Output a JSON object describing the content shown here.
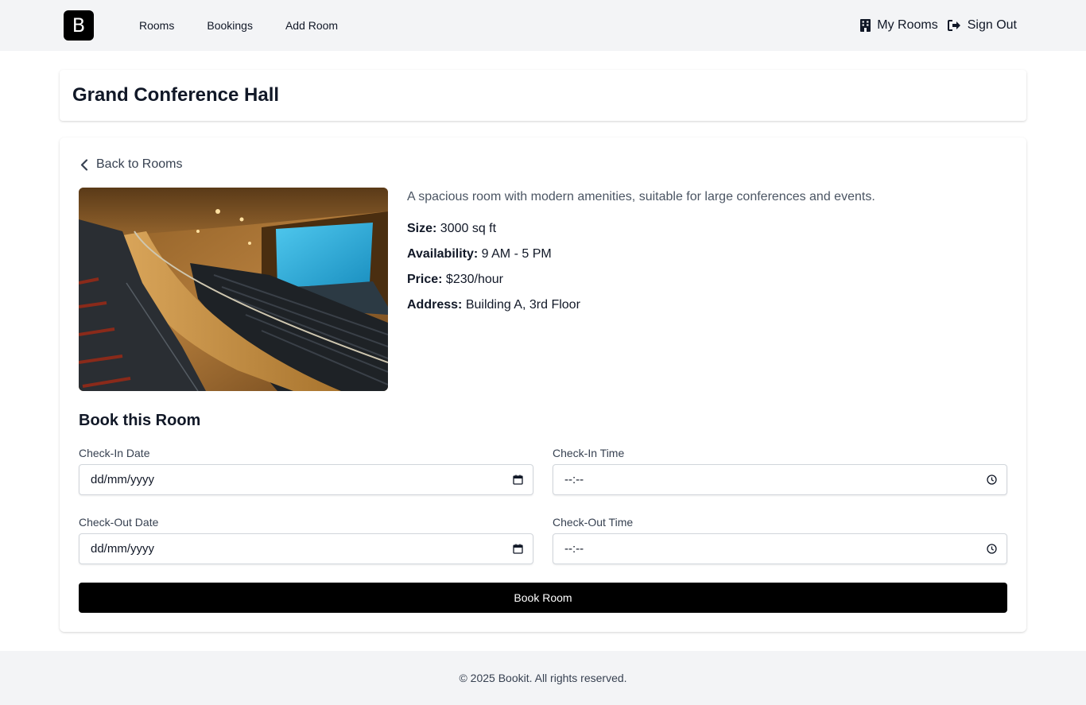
{
  "nav": {
    "logo": "B",
    "links": [
      "Rooms",
      "Bookings",
      "Add Room"
    ],
    "my_rooms": "My Rooms",
    "sign_out": "Sign Out"
  },
  "room": {
    "title": "Grand Conference Hall",
    "back_label": "Back to Rooms",
    "description": "A spacious room with modern amenities, suitable for large conferences and events.",
    "details": [
      {
        "label": "Size:",
        "value": "3000 sq ft"
      },
      {
        "label": "Availability:",
        "value": "9 AM - 5 PM"
      },
      {
        "label": "Price:",
        "value": "$230/hour"
      },
      {
        "label": "Address:",
        "value": "Building A, 3rd Floor"
      }
    ]
  },
  "booking": {
    "title": "Book this Room",
    "checkin_date": {
      "label": "Check-In Date",
      "value": "dd/mm/yyyy"
    },
    "checkin_time": {
      "label": "Check-In Time",
      "value": "--:--"
    },
    "checkout_date": {
      "label": "Check-Out Date",
      "value": "dd/mm/yyyy"
    },
    "checkout_time": {
      "label": "Check-Out Time",
      "value": "--:--"
    },
    "button": "Book Room"
  },
  "footer": {
    "text": "© 2025 Bookit. All rights reserved."
  }
}
